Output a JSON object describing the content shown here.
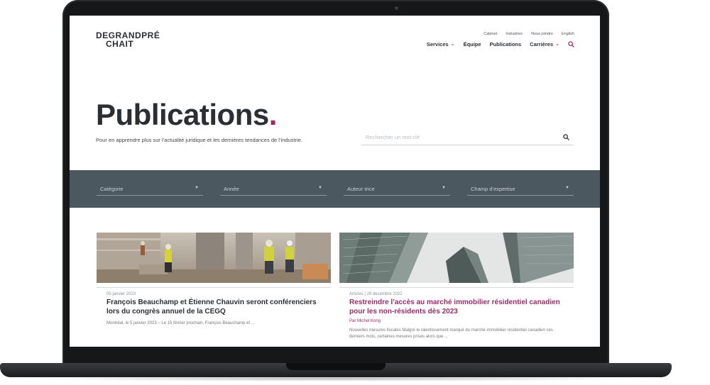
{
  "brand": {
    "logo_line1": "DEGRANDPRÉ",
    "logo_line2": "CHAIT",
    "accent_color": "#9b2b6b",
    "band_color": "#4b5860"
  },
  "top_nav": [
    "Cabinet",
    "Industries",
    "Nous joindre",
    "English"
  ],
  "main_nav": [
    {
      "label": "Services",
      "has_dropdown": true
    },
    {
      "label": "Équipe",
      "has_dropdown": false
    },
    {
      "label": "Publications",
      "has_dropdown": false
    },
    {
      "label": "Carrières",
      "has_dropdown": true
    }
  ],
  "hero": {
    "title": "Publications",
    "title_dot": ".",
    "subtitle": "Pour en apprendre plus sur l’actualité juridique et les dernières tendances de l’industrie."
  },
  "search": {
    "placeholder": "Rechercher un mot-clé",
    "icon": "search-icon"
  },
  "filters": [
    "Catégorie",
    "Année",
    "Auteur·trice",
    "Champ d’expertise"
  ],
  "cards": [
    {
      "meta": "05 janvier 2023",
      "title": "François Beauchamp et Étienne Chauvin seront conférenciers lors du congrès annuel de la CEGQ",
      "title_color": "#2b2f33",
      "author": "",
      "excerpt": "Montréal, le 5 janvier 2023 – Le 15 février prochain, François Beauchamp et ..."
    },
    {
      "meta": "Articles | 29 décembre 2022",
      "title": "Restreindre l’accès au marché immobilier résidentiel canadien pour les non-résidents dès 2023",
      "title_color": "#9b2b6b",
      "author": "Par Michel Kong",
      "excerpt": "Nouvelles mesures fiscales Malgré le ralentissement marqué du marché immobilier résidentiel canadien ces derniers mois, certaines mesures prises alors que ..."
    }
  ]
}
